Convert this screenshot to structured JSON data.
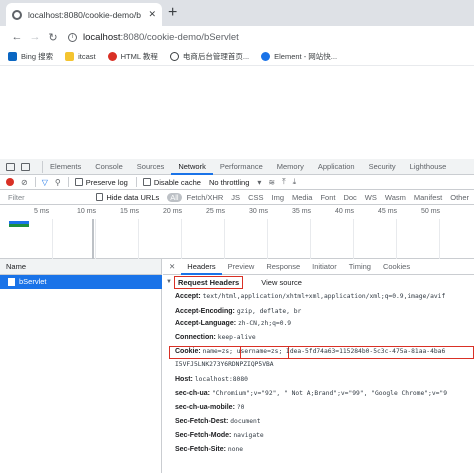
{
  "browser": {
    "tab_title": "localhost:8080/cookie-demo/b",
    "tab_close": "✕",
    "new_tab": "+",
    "url_host": "localhost",
    "url_rest": ":8080/cookie-demo/bServlet",
    "bookmarks": [
      {
        "label": "Bing 搜索",
        "color": "#0a66c2"
      },
      {
        "label": "itcast",
        "color": "#f4c430"
      },
      {
        "label": "HTML 教程",
        "color": "#d93025"
      },
      {
        "label": "电商后台管理首页...",
        "color": "#3c4043"
      },
      {
        "label": "Element - 网站快...",
        "color": "#1a73e8"
      }
    ]
  },
  "devtools": {
    "tabs": [
      "Elements",
      "Console",
      "Sources",
      "Network",
      "Performance",
      "Memory",
      "Application",
      "Security",
      "Lighthouse"
    ],
    "active_tab": "Network",
    "toolbar": {
      "preserve_log": "Preserve log",
      "disable_cache": "Disable cache",
      "throttling": "No throttling"
    },
    "filter": {
      "placeholder": "Filter",
      "hide_data_urls": "Hide data URLs",
      "types": [
        "All",
        "Fetch/XHR",
        "JS",
        "CSS",
        "Img",
        "Media",
        "Font",
        "Doc",
        "WS",
        "Wasm",
        "Manifest",
        "Other"
      ]
    },
    "timeline_ticks": [
      "5 ms",
      "10 ms",
      "15 ms",
      "20 ms",
      "25 ms",
      "30 ms",
      "35 ms",
      "40 ms",
      "45 ms",
      "50 ms"
    ],
    "list_header": "Name",
    "request_name": "bServlet",
    "detail_tabs": [
      "Headers",
      "Preview",
      "Response",
      "Initiator",
      "Timing",
      "Cookies"
    ],
    "detail_close": "✕",
    "active_detail_tab": "Headers",
    "request_headers_title": "Request Headers",
    "view_source": "View source",
    "headers": [
      {
        "k": "Accept:",
        "v": "text/html,application/xhtml+xml,application/xml;q=0.9,image/avif"
      },
      {
        "k": "Accept-Encoding:",
        "v": "gzip, deflate, br"
      },
      {
        "k": "Accept-Language:",
        "v": "zh-CN,zh;q=0.9"
      },
      {
        "k": "Connection:",
        "v": "keep-alive"
      },
      {
        "k": "Cookie:",
        "v": "name=zs; username=zs; Idea-5fd74a63=115284b0-5c3c-475a-81aa-4ba6"
      },
      {
        "k": "",
        "v": "I5VFJ5LNK273Y6RDNPZIQP5VBA"
      },
      {
        "k": "Host:",
        "v": "localhost:8080"
      },
      {
        "k": "sec-ch-ua:",
        "v": "\"Chromium\";v=\"92\", \" Not A;Brand\";v=\"99\", \"Google Chrome\";v=\"9"
      },
      {
        "k": "sec-ch-ua-mobile:",
        "v": "?0"
      },
      {
        "k": "Sec-Fetch-Dest:",
        "v": "document"
      },
      {
        "k": "Sec-Fetch-Mode:",
        "v": "navigate"
      },
      {
        "k": "Sec-Fetch-Site:",
        "v": "none"
      }
    ]
  }
}
